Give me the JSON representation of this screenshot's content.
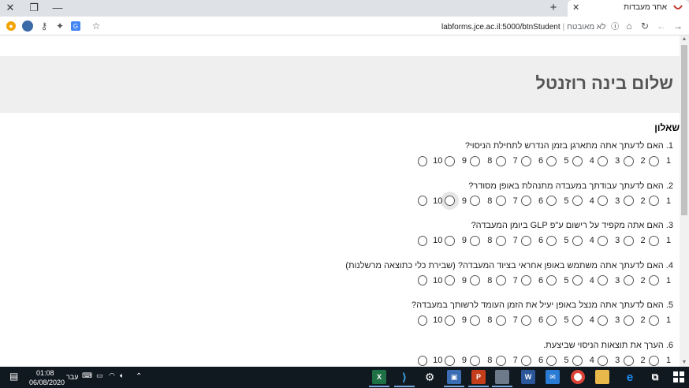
{
  "browser": {
    "tab_title": "אתר מעבדות",
    "tab_close": "✕",
    "new_tab": "+",
    "window_close": "✕",
    "window_restore": "❐",
    "window_minimize": "—",
    "url": "labforms.jce.ac.il:5000/btnStudent",
    "security_label": "לא מאובטח"
  },
  "page": {
    "greeting": "שלום בינה רוזנטל",
    "section_title": "שאלון",
    "scale_labels": [
      "1",
      "2",
      "3",
      "4",
      "5",
      "6",
      "7",
      "8",
      "9",
      "10"
    ],
    "questions": [
      "1. האם לדעתך אתה מתארגן בזמן הנדרש לתחילת הניסוי?",
      "2. האם לדעתך עבודתך במעבדה מתנהלת באופן מסודר?",
      "3. האם אתה מקפיד על רישום ע\"פ GLP ביומן המעבדה?",
      "4. האם לדעתך אתה משתמש באופן אחראי בציוד המעבדה? (שבירת כלי כתוצאה מרשלנות)",
      "5. האם לדעתך אתה מנצל באופן יעיל את הזמן העומד לרשותך במעבדה?",
      "6. הערך את תוצאות הניסוי שביצעת."
    ]
  },
  "taskbar": {
    "time": "01:08",
    "date": "06/08/2020",
    "language": "עבר",
    "apps": [
      "excel",
      "vscode",
      "settings",
      "remote-desktop",
      "powerpoint",
      "chrome-user",
      "word",
      "mail",
      "chrome",
      "file-explorer",
      "edge",
      "task-view"
    ]
  }
}
